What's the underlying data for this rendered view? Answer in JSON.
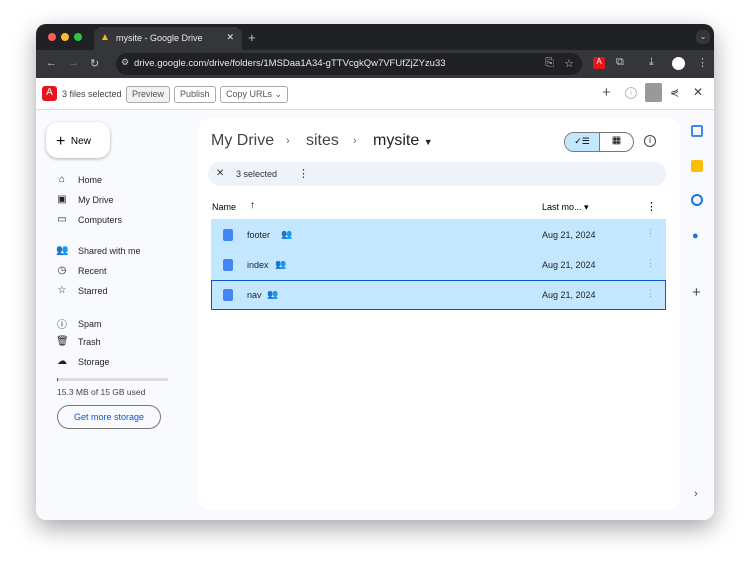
{
  "browser": {
    "tab_title": "mysite - Google Drive",
    "url": "drive.google.com/drive/folders/1MSDaa1A34-gTTVcgkQw7VFUfZjZYzu33"
  },
  "extension": {
    "status": "3 files selected",
    "buttons": [
      "Preview",
      "Publish",
      "Copy URLs"
    ]
  },
  "sidebar": {
    "new_label": "New",
    "items": [
      {
        "label": "Home",
        "icon": "home-icon"
      },
      {
        "label": "My Drive",
        "icon": "drive-icon"
      },
      {
        "label": "Computers",
        "icon": "computer-icon"
      },
      {
        "label": "Shared with me",
        "icon": "people-icon"
      },
      {
        "label": "Recent",
        "icon": "clock-icon"
      },
      {
        "label": "Starred",
        "icon": "star-icon"
      },
      {
        "label": "Spam",
        "icon": "spam-icon"
      },
      {
        "label": "Trash",
        "icon": "trash-icon"
      },
      {
        "label": "Storage",
        "icon": "cloud-icon"
      }
    ],
    "storage_text": "15.3 MB of 15 GB used",
    "storage_fraction": 0.001,
    "get_storage": "Get more storage"
  },
  "breadcrumb": [
    "My Drive",
    "sites",
    "mysite"
  ],
  "selection": {
    "label": "3 selected"
  },
  "table": {
    "headers": {
      "name": "Name",
      "modified": "Last mo..."
    },
    "rows": [
      {
        "name": "footer",
        "date": "Aug 21, 2024"
      },
      {
        "name": "index",
        "date": "Aug 21, 2024"
      },
      {
        "name": "nav",
        "date": "Aug 21, 2024"
      }
    ]
  }
}
